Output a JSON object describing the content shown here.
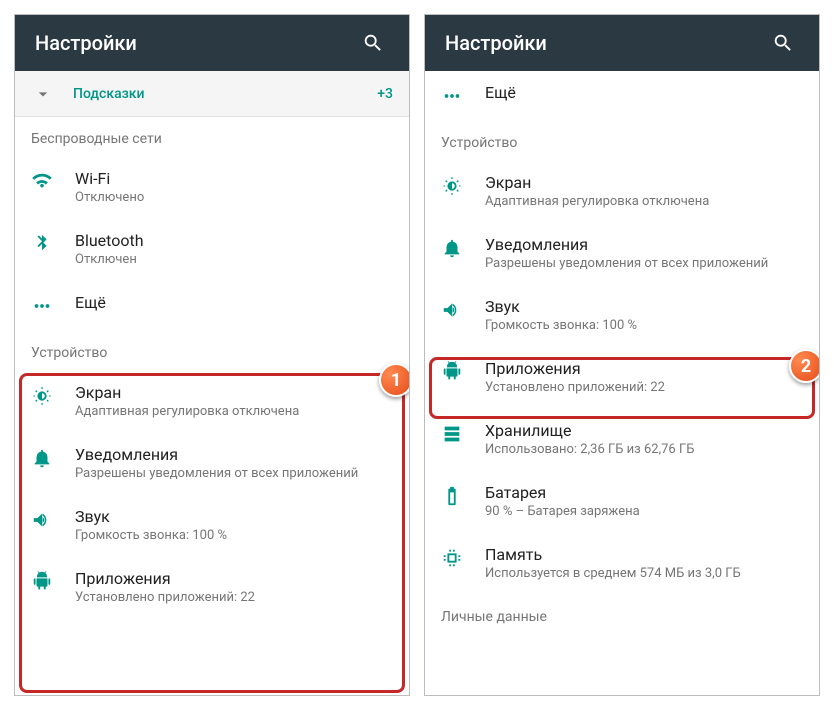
{
  "left": {
    "header_title": "Настройки",
    "hints": {
      "label": "Подсказки",
      "count": "+3"
    },
    "section_wireless": "Беспроводные сети",
    "wifi": {
      "title": "Wi-Fi",
      "sub": "Отключено"
    },
    "bluetooth": {
      "title": "Bluetooth",
      "sub": "Отключен"
    },
    "more": {
      "title": "Ещё"
    },
    "section_device": "Устройство",
    "display": {
      "title": "Экран",
      "sub": "Адаптивная регулировка отключена"
    },
    "notifications": {
      "title": "Уведомления",
      "sub": "Разрешены уведомления от всех приложений"
    },
    "sound": {
      "title": "Звук",
      "sub": "Громкость звонка: 100 %"
    },
    "apps": {
      "title": "Приложения",
      "sub": "Установлено приложений: 22"
    },
    "badge": "1"
  },
  "right": {
    "header_title": "Настройки",
    "more": {
      "title": "Ещё"
    },
    "section_device": "Устройство",
    "display": {
      "title": "Экран",
      "sub": "Адаптивная регулировка отключена"
    },
    "notifications": {
      "title": "Уведомления",
      "sub": "Разрешены уведомления от всех приложений"
    },
    "sound": {
      "title": "Звук",
      "sub": "Громкость звонка: 100 %"
    },
    "apps": {
      "title": "Приложения",
      "sub": "Установлено приложений: 22"
    },
    "storage": {
      "title": "Хранилище",
      "sub": "Использовано: 2,36 ГБ из 62,76 ГБ"
    },
    "battery": {
      "title": "Батарея",
      "sub": "90 % – Батарея заряжена"
    },
    "memory": {
      "title": "Память",
      "sub": "Используется в среднем 574 МБ из 3,0 ГБ"
    },
    "section_personal": "Личные данные",
    "badge": "2"
  }
}
